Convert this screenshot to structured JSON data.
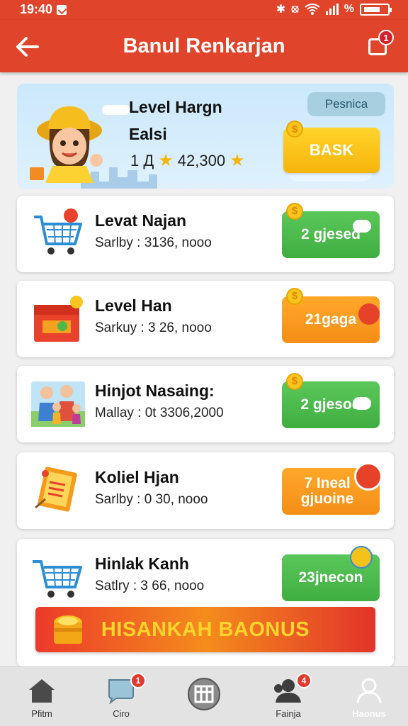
{
  "status": {
    "time": "19:40"
  },
  "header": {
    "title": "Banul Renkarjan",
    "chat_badge": "1"
  },
  "hero": {
    "line1": "Level Hargn",
    "line2": "Ealsi",
    "stat_prefix": "1 Д",
    "stat_value": "42,300",
    "pill": "Pesnica",
    "cta": "BASK"
  },
  "cards": [
    {
      "title": "Levat Najan",
      "subtitle": "Sarlby : 3136, nooo",
      "button": "2 gjesed",
      "color": "green",
      "icon": "cart-icon"
    },
    {
      "title": "Level Han",
      "subtitle": "Sarkuy : 3 26, nooo",
      "button": "21gaga",
      "color": "orange",
      "icon": "gift-box-icon"
    },
    {
      "title": "Hinjot Nasaing:",
      "subtitle": "Mallay : 0t 3306,2000",
      "button": "2 gjesod",
      "color": "green",
      "icon": "family-icon"
    },
    {
      "title": "Koliel Hjan",
      "subtitle": "Sarlby : 0 30, nooo",
      "button": "7 Ineal gjuoine",
      "color": "orange",
      "icon": "certificate-icon"
    },
    {
      "title": "Hinlak Kanh",
      "subtitle": "Satlry : 3 66, nooo",
      "button": "23jnecon",
      "color": "green",
      "icon": "cart-icon"
    }
  ],
  "bonus": {
    "label": "HISANKAH BAONUS"
  },
  "nav": [
    {
      "label": "Pfitm",
      "icon": "home-icon"
    },
    {
      "label": "Ciro",
      "icon": "chat-icon",
      "badge": "1"
    },
    {
      "label": "",
      "icon": "grid-icon"
    },
    {
      "label": "Fainja",
      "icon": "group-icon",
      "badge": "4"
    },
    {
      "label": "Haonus",
      "icon": "user-icon"
    }
  ]
}
